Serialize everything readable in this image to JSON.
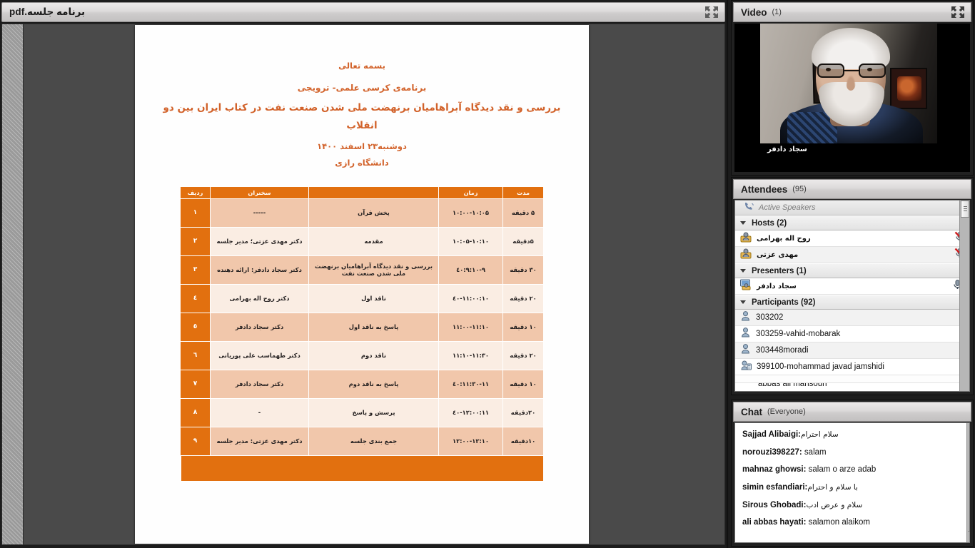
{
  "document_pod": {
    "title": "برنامه جلسه.pdf",
    "expand_icon": "expand-icon",
    "pdf": {
      "bismillah": "بسمه تعالی",
      "program_line": "برنامه‌ی کرسی علمی- ترویجی",
      "main_title": "بررسی و نقد دیدگاه آبراهامیان برنهضت ملی شدن  صنعت نفت در کتاب ایران بین دو انقلاب",
      "date": "دوشنبه۲۳ اسفند ۱۴۰۰",
      "university": "دانشگاه رازی",
      "table": {
        "headers": {
          "duration": "مدت",
          "time": "زمان",
          "topic": "",
          "speaker": "سخنران",
          "row_no": "ردیف"
        },
        "rows": [
          {
            "no": "۱",
            "speaker": "-----",
            "topic": "پخش قرآن",
            "time": "۱۰:۰۰-۱۰:۰۵",
            "duration": "۵ دقیقه"
          },
          {
            "no": "۲",
            "speaker": "دکتر مهدی عزتی؛ مدیر جلسه",
            "topic": "مقدمه",
            "time": "۱۰:۰۵-۱۰:۱۰",
            "duration": "۵دقیقه"
          },
          {
            "no": "۳",
            "speaker": "دکتر سجاد دادفر: ارائه دهنده",
            "topic": "بررسی و نقد دیدگاه آبراهامیان برنهضت ملی شدن صنعت نفت",
            "time": "۹:۱۰-۹:٤۰",
            "duration": "۳۰ دقیقه"
          },
          {
            "no": "٤",
            "speaker": "دکتر  روح اله بهرامی",
            "topic": "ناقد اول",
            "time": "۱۰:٤۰-۱۱:۰۰",
            "duration": "۲۰ دقیقه"
          },
          {
            "no": "٥",
            "speaker": "دکتر سجاد دادفر",
            "topic": "پاسخ به ناقد اول",
            "time": "۱۱:۰۰-۱۱:۱۰",
            "duration": "۱۰ دقیقه"
          },
          {
            "no": "٦",
            "speaker": "دکتر طهماسب علی پوریانی",
            "topic": "ناقد دوم",
            "time": "۱۱:۱۰-۱۱:۳۰",
            "duration": "۲۰ دقیقه"
          },
          {
            "no": "۷",
            "speaker": "دکتر سجاد دادفر",
            "topic": "پاسخ به ناقد دوم",
            "time": "۱۱:۳۰-۱۱:٤۰",
            "duration": "۱۰ دقیقه"
          },
          {
            "no": "۸",
            "speaker": "-",
            "topic": "پرسش و پاسخ",
            "time": "۱۱:٤۰-۱۲:۰۰",
            "duration": "۲۰دقیقه"
          },
          {
            "no": "۹",
            "speaker": "دکتر مهدی عزتی: مدیر جلسه",
            "topic": "جمع بندی جلسه",
            "time": "۱۲:۰۰-۱۲:۱۰",
            "duration": "۱۰دقیقه"
          }
        ]
      }
    }
  },
  "video_pod": {
    "title": "Video",
    "count": "(1)",
    "expand_icon": "expand-icon",
    "participant_name": "سجاد دادفر"
  },
  "attendees_pod": {
    "title": "Attendees",
    "count": "(95)",
    "active_speakers_label": "Active Speakers",
    "active_speakers_icon": "active-speaker-icon",
    "groups": [
      {
        "label": "Hosts (2)",
        "members": [
          {
            "name": "روح اله بهرامی",
            "rtl": true,
            "icon": "host-icon",
            "status_icon": "mic-muted-icon"
          },
          {
            "name": "مهدی عزتی",
            "rtl": true,
            "icon": "host-icon",
            "status_icon": "mic-muted-icon"
          }
        ]
      },
      {
        "label": "Presenters (1)",
        "members": [
          {
            "name": "سجاد دادفر",
            "rtl": true,
            "icon": "presenter-icon",
            "status_icon": "mic-active-icon"
          }
        ]
      },
      {
        "label": "Participants (92)",
        "members": [
          {
            "name": "303202",
            "rtl": false,
            "icon": "participant-icon",
            "status_icon": ""
          },
          {
            "name": "303259-vahid-mobarak",
            "rtl": false,
            "icon": "participant-icon",
            "status_icon": ""
          },
          {
            "name": "303448moradi",
            "rtl": false,
            "icon": "participant-icon",
            "status_icon": ""
          },
          {
            "name": "399100-mohammad javad jamshidi",
            "rtl": false,
            "icon": "participant-webcam-icon",
            "status_icon": ""
          },
          {
            "name": "abbas ali mansouri",
            "rtl": false,
            "icon": "participant-icon",
            "status_icon": ""
          }
        ]
      }
    ]
  },
  "chat_pod": {
    "title": "Chat",
    "scope": "(Everyone)",
    "messages": [
      {
        "sender": "Sajjad Alibaigi",
        "text": "سلام   احترام"
      },
      {
        "sender": "norouzi398227",
        "text": "salam"
      },
      {
        "sender": "mahnaz ghowsi",
        "text": "salam o arze adab"
      },
      {
        "sender": "simin esfandiari",
        "text": "با سلام و احترام"
      },
      {
        "sender": "Sirous Ghobadi",
        "text": "سلام و عرض ادب"
      },
      {
        "sender": "ali abbas hayati",
        "text": "salamon alaikom"
      }
    ]
  },
  "colors": {
    "accent_orange": "#E2700F",
    "table_row_dark": "#F1C7AB",
    "table_row_light": "#FAEDE3",
    "pdf_text": "#D2622A"
  }
}
